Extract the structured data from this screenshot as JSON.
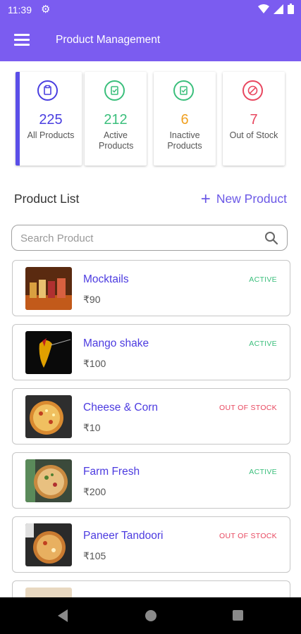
{
  "status_bar": {
    "time": "11:39"
  },
  "app_bar": {
    "title": "Product Management"
  },
  "colors": {
    "primary": "#7b5cf0",
    "active": "#3bbf7c",
    "inactive": "#f0a020",
    "out_of_stock": "#e8475f"
  },
  "stats": [
    {
      "value": "225",
      "label": "All Products",
      "icon": "clipboard-icon",
      "color": "#4a3fe0"
    },
    {
      "value": "212",
      "label": "Active Products",
      "icon": "clipboard-check-icon",
      "color": "#3bbf7c"
    },
    {
      "value": "6",
      "label": "Inactive Products",
      "icon": "clipboard-check-icon",
      "color": "#f0a020"
    },
    {
      "value": "7",
      "label": "Out of Stock",
      "icon": "block-icon",
      "color": "#e8475f"
    }
  ],
  "product_list": {
    "title": "Product List",
    "new_button": "New Product"
  },
  "search": {
    "placeholder": "Search Product",
    "value": ""
  },
  "products": [
    {
      "name": "Mocktails",
      "price": "₹90",
      "status": "ACTIVE",
      "thumb": "mocktails"
    },
    {
      "name": "Mango shake",
      "price": "₹100",
      "status": "ACTIVE",
      "thumb": "mango"
    },
    {
      "name": "Cheese & Corn",
      "price": "₹10",
      "status": "OUT OF STOCK",
      "thumb": "pizza"
    },
    {
      "name": "Farm Fresh",
      "price": "₹200",
      "status": "ACTIVE",
      "thumb": "pizza2"
    },
    {
      "name": "Paneer Tandoori",
      "price": "₹105",
      "status": "OUT OF STOCK",
      "thumb": "pizza3"
    }
  ]
}
